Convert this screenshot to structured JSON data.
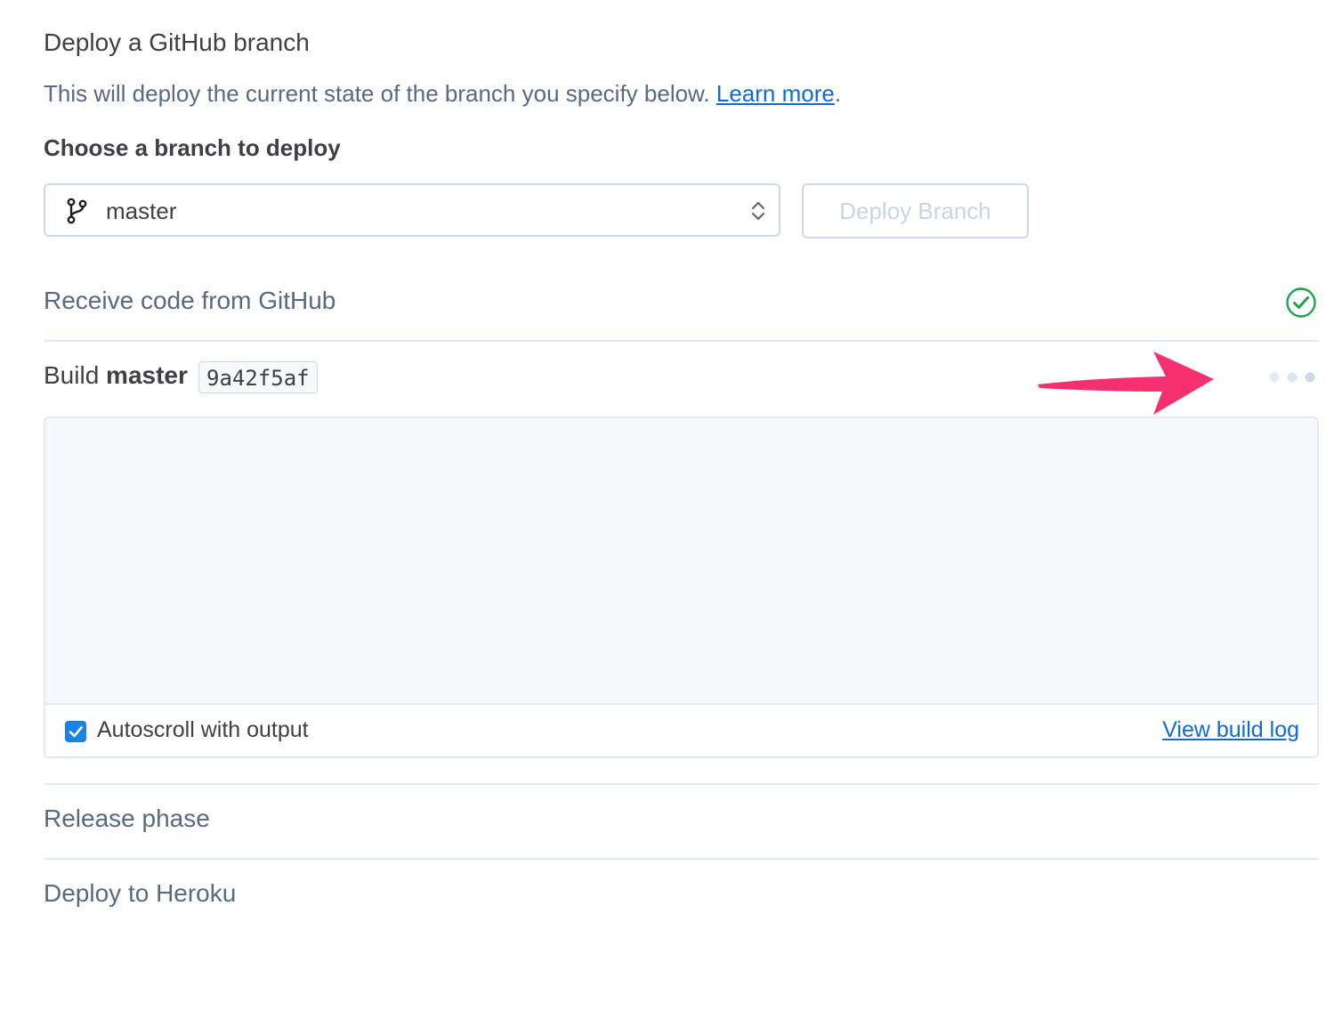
{
  "header": {
    "title": "Deploy a GitHub branch",
    "description": "This will deploy the current state of the branch you specify below.",
    "learn_more": "Learn more",
    "period": "."
  },
  "branch_picker": {
    "label": "Choose a branch to deploy",
    "selected": "master",
    "icon": "git-branch-icon",
    "caret_icon": "select-caret-icon"
  },
  "deploy_button": {
    "label": "Deploy Branch"
  },
  "steps": {
    "receive": {
      "label": "Receive code from GitHub",
      "status_icon": "check-circle-icon",
      "status_color": "#1aa34a"
    },
    "build": {
      "prefix": "Build",
      "branch": "master",
      "commit": "9a42f5af",
      "status_icon": "loading-dots-icon"
    },
    "release": {
      "label": "Release phase"
    },
    "deploy": {
      "label": "Deploy to Heroku"
    }
  },
  "build_log": {
    "autoscroll_label": "Autoscroll with output",
    "autoscroll_checked": true,
    "view_log": "View build log"
  },
  "annotation": {
    "arrow_color": "#f5306e"
  },
  "colors": {
    "link": "#0f6bd6",
    "checkbox": "#1a82e2",
    "muted_text": "#596981"
  }
}
